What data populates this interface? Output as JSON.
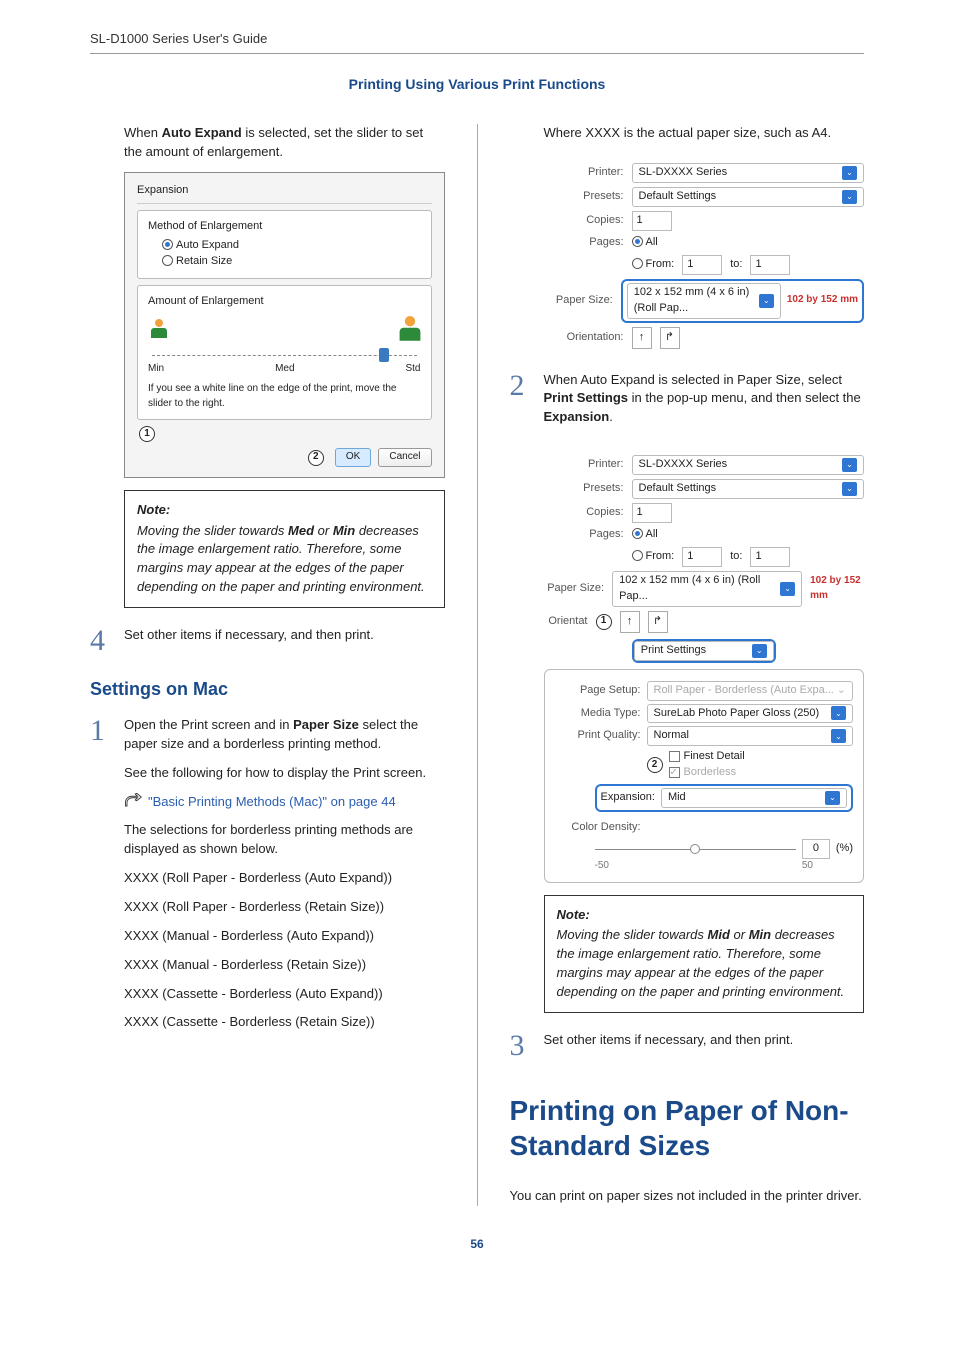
{
  "header": {
    "guide_title": "SL-D1000 Series User's Guide",
    "section": "Printing Using Various Print Functions"
  },
  "left": {
    "intro": {
      "prefix": "When ",
      "bold": "Auto Expand",
      "suffix": " is selected, set the slider to set the amount of enlargement."
    },
    "shot1": {
      "title": "Expansion",
      "method_label": "Method of Enlargement",
      "opt_auto": "Auto Expand",
      "opt_retain": "Retain Size",
      "amount_label": "Amount of Enlargement",
      "min": "Min",
      "med": "Med",
      "std": "Std",
      "tip": "If you see a white line on the edge of the print, move the slider to the right.",
      "ok": "OK",
      "cancel": "Cancel"
    },
    "note1": {
      "title": "Note:",
      "body_prefix": "Moving the slider towards ",
      "b1": "Med",
      "mid": " or ",
      "b2": "Min",
      "body_suffix": " decreases the image enlargement ratio. Therefore, some margins may appear at the edges of the paper depending on the paper and printing environment."
    },
    "step4": "Set other items if necessary, and then print.",
    "settings_heading": "Settings on Mac",
    "step1": {
      "p1_prefix": "Open the Print screen and in ",
      "p1_bold": "Paper Size",
      "p1_suffix": " select the paper size and a borderless printing method.",
      "p2": "See the following for how to display the Print screen.",
      "link": "\"Basic Printing Methods (Mac)\" on page 44",
      "p3": "The selections for borderless printing methods are displayed as shown below.",
      "l1": "XXXX (Roll Paper - Borderless (Auto Expand))",
      "l2": "XXXX (Roll Paper - Borderless (Retain Size))",
      "l3": "XXXX (Manual - Borderless (Auto Expand))",
      "l4": "XXXX (Manual - Borderless (Retain Size))",
      "l5": "XXXX (Cassette - Borderless (Auto Expand))",
      "l6": "XXXX (Cassette - Borderless (Retain Size))"
    }
  },
  "right": {
    "top": "Where XXXX is the actual paper size, such as A4.",
    "mac1": {
      "printer_label": "Printer:",
      "printer_value": "SL-DXXXX Series",
      "presets_label": "Presets:",
      "presets_value": "Default Settings",
      "copies_label": "Copies:",
      "copies_value": "1",
      "pages_label": "Pages:",
      "all": "All",
      "from": "From:",
      "from_v": "1",
      "to": "to:",
      "to_v": "1",
      "paper_size_label": "Paper Size:",
      "paper_size_value": "102 x 152 mm (4 x 6 in) (Roll Pap...",
      "size_tag": "102 by 152 mm",
      "orientation_label": "Orientation:"
    },
    "step2": {
      "prefix": "When Auto Expand is selected in Paper Size, select ",
      "b1": "Print Settings",
      "mid": " in the pop-up menu, and then select the ",
      "b2": "Expansion",
      "suffix": "."
    },
    "mac2": {
      "print_settings": "Print Settings",
      "page_setup_label": "Page Setup:",
      "page_setup_value": "Roll Paper - Borderless (Auto Expa...",
      "media_type_label": "Media Type:",
      "media_type_value": "SureLab Photo Paper Gloss (250)",
      "quality_label": "Print Quality:",
      "quality_value": "Normal",
      "finest": "Finest Detail",
      "borderless": "Borderless",
      "expansion_label": "Expansion:",
      "expansion_value": "Mid",
      "density_label": "Color Density:",
      "density_value": "0",
      "density_pct": "(%)",
      "density_min": "-50",
      "density_max": "50"
    },
    "note2": {
      "title": "Note:",
      "body_prefix": "Moving the slider towards ",
      "b1": "Mid",
      "mid": " or ",
      "b2": "Min",
      "body_suffix": " decreases the image enlargement ratio. Therefore, some margins may appear at the edges of the paper depending on the paper and printing environment."
    },
    "step3": "Set other items if necessary, and then print.",
    "big_title": "Printing on Paper of Non-Standard Sizes",
    "footer_para": "You can print on paper sizes not included in the printer driver."
  },
  "page_number": "56"
}
